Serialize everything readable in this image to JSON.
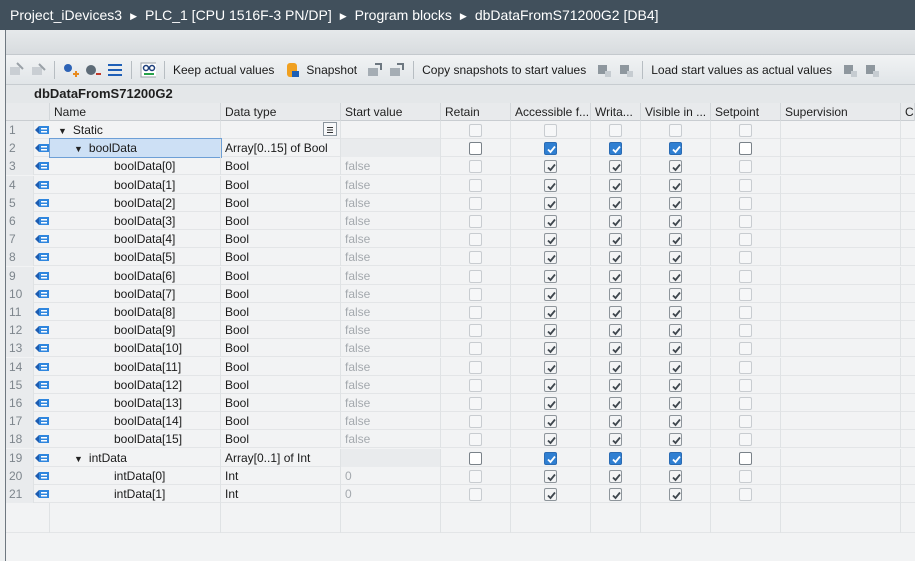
{
  "breadcrumb": [
    "Project_iDevices3",
    "PLC_1 [CPU 1516F-3 PN/DP]",
    "Program blocks",
    "dbDataFromS71200G2 [DB4]"
  ],
  "toolbar": {
    "keep_actual": "Keep actual values",
    "snapshot": "Snapshot",
    "copy_snapshots": "Copy snapshots to start values",
    "load_start": "Load start values as actual values"
  },
  "db_title": "dbDataFromS71200G2",
  "columns": [
    "Name",
    "Data type",
    "Start value",
    "Retain",
    "Accessible f...",
    "Writa...",
    "Visible in ...",
    "Setpoint",
    "Supervision",
    "C"
  ],
  "rows": [
    {
      "n": "1",
      "name": "Static",
      "type": "",
      "start": "",
      "level": 0,
      "expand": true,
      "checks": "off"
    },
    {
      "n": "2",
      "name": "boolData",
      "type": "Array[0..15] of Bool",
      "start": "",
      "level": 1,
      "expand": true,
      "checks": "parent",
      "selected": true
    },
    {
      "n": "3",
      "name": "boolData[0]",
      "type": "Bool",
      "start": "false",
      "level": 2,
      "checks": "child"
    },
    {
      "n": "4",
      "name": "boolData[1]",
      "type": "Bool",
      "start": "false",
      "level": 2,
      "checks": "child"
    },
    {
      "n": "5",
      "name": "boolData[2]",
      "type": "Bool",
      "start": "false",
      "level": 2,
      "checks": "child"
    },
    {
      "n": "6",
      "name": "boolData[3]",
      "type": "Bool",
      "start": "false",
      "level": 2,
      "checks": "child"
    },
    {
      "n": "7",
      "name": "boolData[4]",
      "type": "Bool",
      "start": "false",
      "level": 2,
      "checks": "child"
    },
    {
      "n": "8",
      "name": "boolData[5]",
      "type": "Bool",
      "start": "false",
      "level": 2,
      "checks": "child"
    },
    {
      "n": "9",
      "name": "boolData[6]",
      "type": "Bool",
      "start": "false",
      "level": 2,
      "checks": "child"
    },
    {
      "n": "10",
      "name": "boolData[7]",
      "type": "Bool",
      "start": "false",
      "level": 2,
      "checks": "child"
    },
    {
      "n": "11",
      "name": "boolData[8]",
      "type": "Bool",
      "start": "false",
      "level": 2,
      "checks": "child"
    },
    {
      "n": "12",
      "name": "boolData[9]",
      "type": "Bool",
      "start": "false",
      "level": 2,
      "checks": "child"
    },
    {
      "n": "13",
      "name": "boolData[10]",
      "type": "Bool",
      "start": "false",
      "level": 2,
      "checks": "child"
    },
    {
      "n": "14",
      "name": "boolData[11]",
      "type": "Bool",
      "start": "false",
      "level": 2,
      "checks": "child"
    },
    {
      "n": "15",
      "name": "boolData[12]",
      "type": "Bool",
      "start": "false",
      "level": 2,
      "checks": "child"
    },
    {
      "n": "16",
      "name": "boolData[13]",
      "type": "Bool",
      "start": "false",
      "level": 2,
      "checks": "child"
    },
    {
      "n": "17",
      "name": "boolData[14]",
      "type": "Bool",
      "start": "false",
      "level": 2,
      "checks": "child"
    },
    {
      "n": "18",
      "name": "boolData[15]",
      "type": "Bool",
      "start": "false",
      "level": 2,
      "checks": "child"
    },
    {
      "n": "19",
      "name": "intData",
      "type": "Array[0..1] of Int",
      "start": "",
      "level": 1,
      "expand": true,
      "checks": "parent"
    },
    {
      "n": "20",
      "name": "intData[0]",
      "type": "Int",
      "start": "0",
      "level": 2,
      "checks": "child"
    },
    {
      "n": "21",
      "name": "intData[1]",
      "type": "Int",
      "start": "0",
      "level": 2,
      "checks": "child"
    }
  ],
  "colors": {
    "titlebar": "#41505c",
    "selection": "#cde0f5",
    "check_blue": "#2f7fd2"
  },
  "icons": [
    "db-tag-icon",
    "expand-triangle-icon",
    "checkbox-icon",
    "dropdown-list-icon",
    "snapshot-icon",
    "keep-values-icon"
  ]
}
